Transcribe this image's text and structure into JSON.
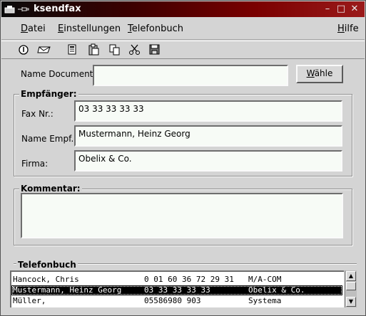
{
  "window": {
    "title": "ksendfax",
    "controls": [
      "window-menu-icon",
      "pin-icon",
      "minimize-icon",
      "maximize-icon",
      "close-icon"
    ]
  },
  "menubar": {
    "items": [
      {
        "label": "Datei",
        "underline": "D",
        "rest": "atei"
      },
      {
        "label": "Einstellungen",
        "underline": "E",
        "rest": "instellungen"
      },
      {
        "label": "Telefonbuch",
        "underline": "T",
        "rest": "elefonbuch"
      },
      {
        "label": "Hilfe",
        "underline": "H",
        "rest": "ilfe"
      }
    ]
  },
  "toolbar": {
    "icons": [
      "info-icon",
      "send-fax-icon",
      "phonebook-icon",
      "paste-icon",
      "copy-icon",
      "cut-icon",
      "save-icon"
    ]
  },
  "document": {
    "label": "Name Document:",
    "value": "",
    "button_label": "Wähle",
    "button_underline": "W",
    "button_rest": "ähle"
  },
  "recipient": {
    "group_title": "Empfänger:",
    "fax_label": "Fax Nr.:",
    "fax_value": "03 33 33 33 33",
    "name_label": "Name Empf.:",
    "name_value": "Mustermann, Heinz Georg",
    "company_label": "Firma:",
    "company_value": "Obelix & Co."
  },
  "comment": {
    "group_title": "Kommentar:",
    "value": ""
  },
  "phonebook": {
    "title": "Telefonbuch",
    "rows": [
      {
        "name": "Hancock, Chris",
        "number": "0 01 60 36 72 29 31",
        "company": "M/A-COM",
        "selected": false
      },
      {
        "name": "Mustermann, Heinz Georg",
        "number": "03 33 33 33 33",
        "company": "Obelix & Co.",
        "selected": true
      },
      {
        "name": "Müller,",
        "number": "05586980 903",
        "company": "Systema",
        "selected": false
      }
    ]
  }
}
